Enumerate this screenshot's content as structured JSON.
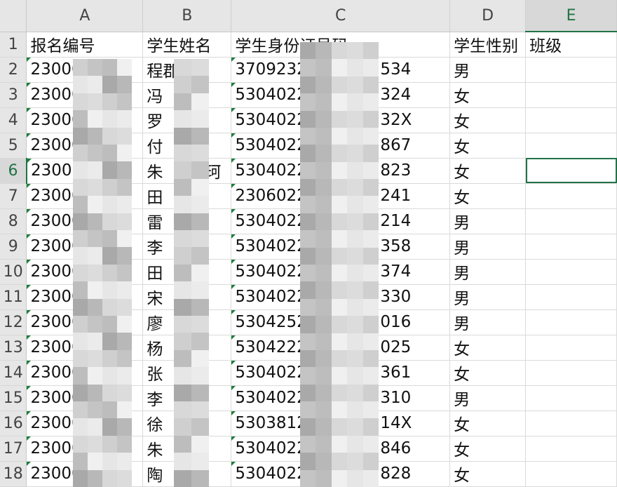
{
  "columns": [
    "A",
    "B",
    "C",
    "D",
    "E"
  ],
  "active_column": "E",
  "active_row": "6",
  "header_row": {
    "row_number": "1",
    "A": "报名编号",
    "B": "学生姓名",
    "C": "学生身份证号码",
    "D": "学生性别",
    "E": "班级"
  },
  "rows": [
    {
      "n": "2",
      "A": "23000",
      "B": "程郡",
      "C": "3709232",
      "C_tail": "534",
      "D": "男",
      "E": ""
    },
    {
      "n": "3",
      "A": "23000",
      "B": "冯",
      "C": "5304022",
      "C_tail": "324",
      "D": "女",
      "E": ""
    },
    {
      "n": "4",
      "A": "23000",
      "B": "罗",
      "C": "5304022",
      "C_tail": "32X",
      "D": "女",
      "E": ""
    },
    {
      "n": "5",
      "A": "23000",
      "B": "付",
      "C": "5304022",
      "C_tail": "867",
      "D": "女",
      "E": ""
    },
    {
      "n": "6",
      "A": "23000",
      "B": "朱",
      "B_tail": "珂",
      "C": "5304022",
      "C_tail": "823",
      "D": "女",
      "E": ""
    },
    {
      "n": "7",
      "A": "23000",
      "B": "田",
      "C": "2306022",
      "C_tail": "241",
      "D": "女",
      "E": ""
    },
    {
      "n": "8",
      "A": "23000",
      "B": "雷",
      "C": "5304022",
      "C_tail": "214",
      "D": "男",
      "E": ""
    },
    {
      "n": "9",
      "A": "23000",
      "B": "李",
      "C": "5304022",
      "C_tail": "358",
      "D": "男",
      "E": ""
    },
    {
      "n": "10",
      "A": "23000",
      "B": "田",
      "C": "5304022",
      "C_tail": "374",
      "D": "男",
      "E": ""
    },
    {
      "n": "11",
      "A": "23000",
      "B": "宋",
      "C": "5304022",
      "C_tail": "330",
      "D": "男",
      "E": ""
    },
    {
      "n": "12",
      "A": "23000",
      "B": "廖",
      "C": "5304252",
      "C_tail": "016",
      "D": "男",
      "E": ""
    },
    {
      "n": "13",
      "A": "23000",
      "B": "杨",
      "C": "5304222",
      "C_tail": "025",
      "D": "女",
      "E": ""
    },
    {
      "n": "14",
      "A": "23000",
      "B": "张",
      "C": "5304022",
      "C_tail": "361",
      "D": "女",
      "E": ""
    },
    {
      "n": "15",
      "A": "23000",
      "B": "李",
      "C": "5304022",
      "C_tail": "310",
      "D": "男",
      "E": ""
    },
    {
      "n": "16",
      "A": "23000",
      "B": "徐",
      "C": "5303812",
      "C_tail": "14X",
      "D": "女",
      "E": ""
    },
    {
      "n": "17",
      "A": "23000",
      "B": "朱",
      "C": "5304022",
      "C_tail": "846",
      "D": "女",
      "E": ""
    },
    {
      "n": "18",
      "A": "23000",
      "B": "陶",
      "C": "5304022",
      "C_tail": "828",
      "D": "女",
      "E": ""
    }
  ],
  "colors": {
    "accent": "#217346",
    "header_bg": "#e6e6e6",
    "gridline": "#dadada"
  }
}
